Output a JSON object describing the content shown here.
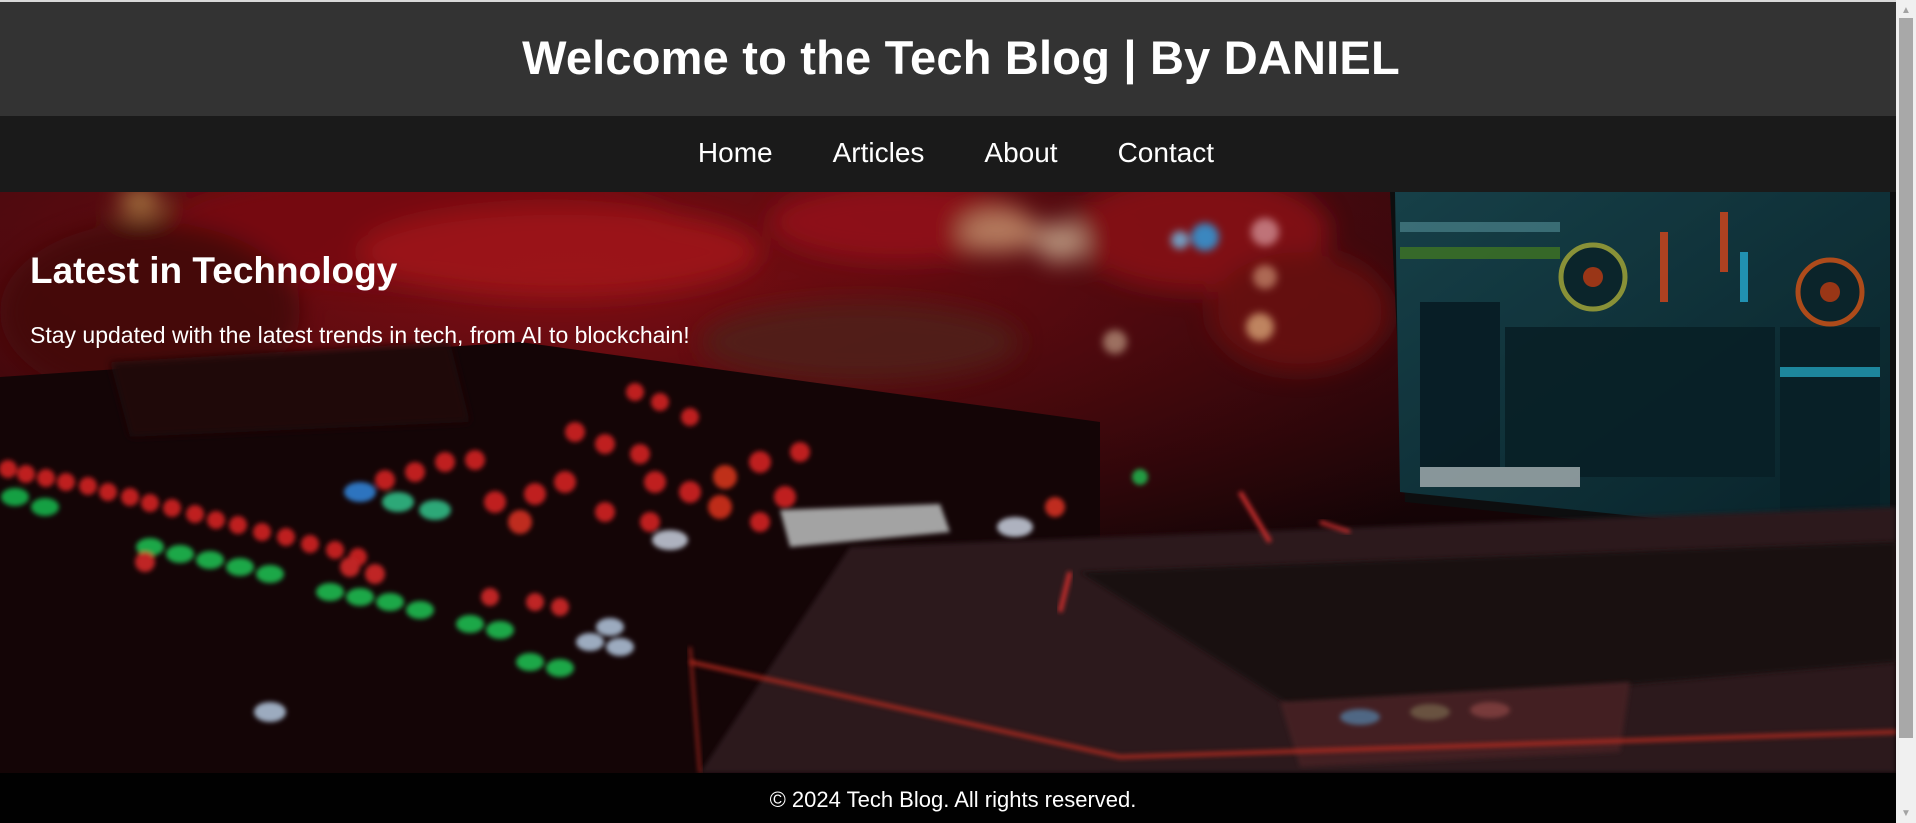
{
  "header": {
    "title": "Welcome to the Tech Blog | By DANIEL"
  },
  "nav": {
    "items": [
      {
        "label": "Home"
      },
      {
        "label": "Articles"
      },
      {
        "label": "About"
      },
      {
        "label": "Contact"
      }
    ]
  },
  "hero": {
    "heading": "Latest in Technology",
    "text": "Stay updated with the latest trends in tech, from AI to blockchain!",
    "background_image": "blurred-dj-mixer-and-laptop-photo"
  },
  "footer": {
    "text": "© 2024 Tech Blog. All rights reserved."
  },
  "scrollbar": {
    "up_icon": "triangle-up-icon",
    "down_icon": "triangle-down-icon"
  },
  "colors": {
    "header_bg": "#333333",
    "nav_bg": "#1a1a1a",
    "footer_bg": "#000000",
    "text": "#ffffff"
  }
}
